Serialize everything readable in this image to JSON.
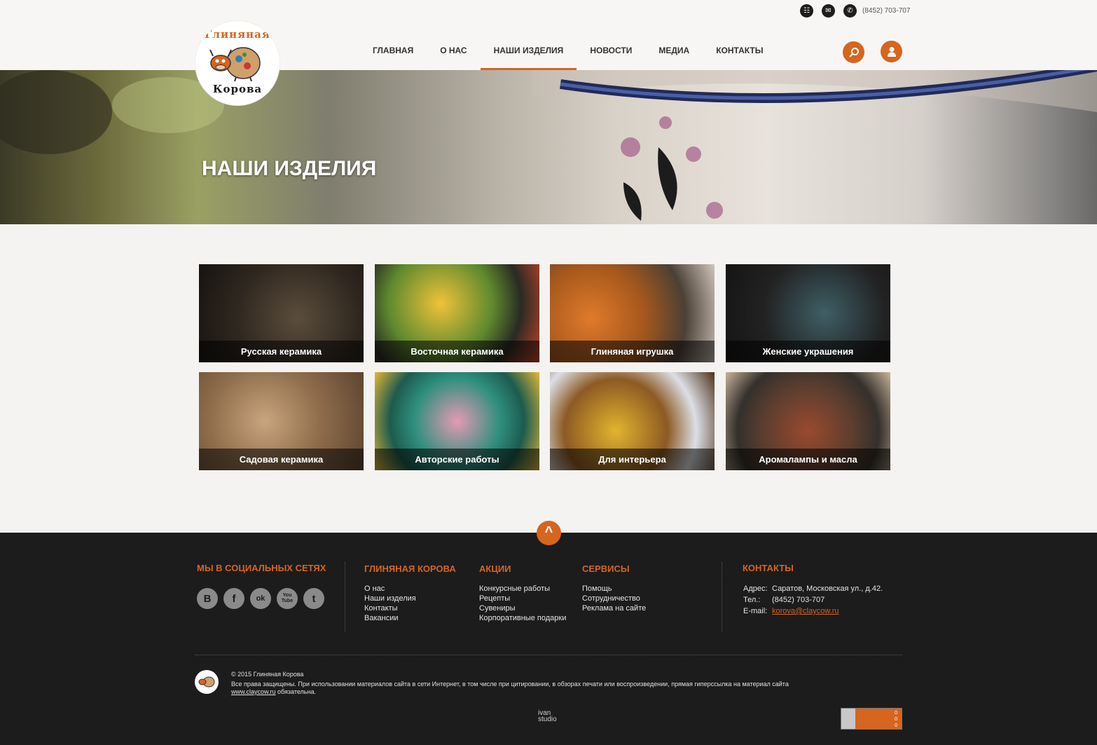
{
  "header": {
    "phone": "(8452) 703-707",
    "icons": [
      "sitemap-icon",
      "mail-icon",
      "phone-icon"
    ],
    "logo": {
      "top": "Глиняная",
      "bottom": "Корова"
    },
    "nav": [
      {
        "label": "ГЛАВНАЯ",
        "active": false
      },
      {
        "label": "О НАС",
        "active": false
      },
      {
        "label": "НАШИ ИЗДЕЛИЯ",
        "active": true
      },
      {
        "label": "НОВОСТИ",
        "active": false
      },
      {
        "label": "МЕДИА",
        "active": false
      },
      {
        "label": "КОНТАКТЫ",
        "active": false
      }
    ],
    "search_icon": "search-icon",
    "account_icon": "user-icon"
  },
  "hero": {
    "title": "НАШИ ИЗДЕЛИЯ"
  },
  "categories": [
    {
      "label": "Русская керамика"
    },
    {
      "label": "Восточная керамика"
    },
    {
      "label": "Глиняная игрушка"
    },
    {
      "label": "Женские украшения"
    },
    {
      "label": "Садовая керамика"
    },
    {
      "label": "Авторские работы"
    },
    {
      "label": "Для интерьера"
    },
    {
      "label": "Аромалампы и масла"
    }
  ],
  "footer": {
    "social": {
      "title": "МЫ В СОЦИАЛЬНЫХ СЕТЯХ",
      "icons": [
        {
          "name": "vk-icon",
          "glyph": "B"
        },
        {
          "name": "facebook-icon",
          "glyph": "f"
        },
        {
          "name": "odnoklassniki-icon",
          "glyph": "ok"
        },
        {
          "name": "youtube-icon",
          "glyph": "You Tube"
        },
        {
          "name": "twitter-icon",
          "glyph": "t"
        }
      ]
    },
    "col1": {
      "title": "ГЛИНЯНАЯ КОРОВА",
      "items": [
        "О нас",
        "Наши изделия",
        "Контакты",
        "Вакансии"
      ]
    },
    "col2": {
      "title": "АКЦИИ",
      "items": [
        "Конкурсные работы",
        "Рецепты",
        "Сувениры",
        "Корпоративные подарки"
      ]
    },
    "col3": {
      "title": "СЕРВИСЫ",
      "items": [
        "Помощь",
        "Сотрудничество",
        "Реклама на сайте"
      ]
    },
    "contacts": {
      "title": "КОНТАКТЫ",
      "address_label": "Адрес:",
      "address": "Саратов, Московская ул., д.42.",
      "phone_label": "Тел.:",
      "phone": "(8452) 703-707",
      "email_label": "E-mail:",
      "email": "korova@claycow.ru"
    },
    "copyright": "© 2015 Глиняная Корова",
    "rights": "Все права защищены. При использовании материалов сайта в сети Интернет, в том числе при цитировании, в обзорах печати или воспроизведении, прямая гиперссылка на материал сайта",
    "site_link": "www.claycow.ru",
    "rights_end": "обязательна.",
    "studio": {
      "line1": "ivan",
      "line2": "studio"
    },
    "counter": [
      "0",
      "0",
      "0"
    ]
  },
  "colors": {
    "accent": "#d6651f",
    "footer_bg": "#1c1c1c",
    "page_bg": "#f4f3f1"
  }
}
